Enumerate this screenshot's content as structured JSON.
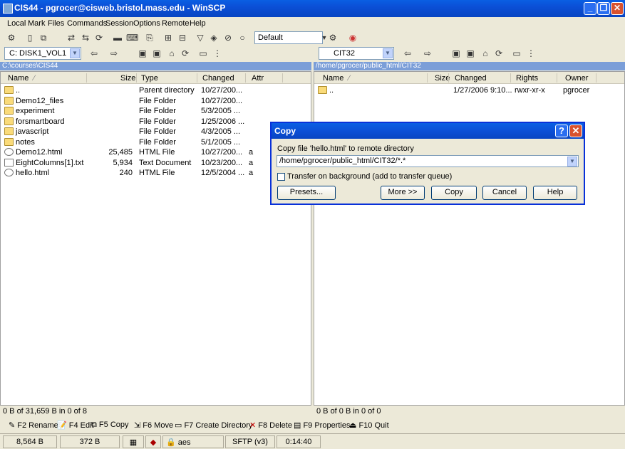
{
  "window": {
    "title": "CIS44 - pgrocer@cisweb.bristol.mass.edu - WinSCP"
  },
  "menu": [
    "Local",
    "Mark",
    "Files",
    "Commands",
    "Session",
    "Options",
    "Remote",
    "Help"
  ],
  "toolbar": {
    "profile": "Default"
  },
  "left": {
    "drive": "C: DISK1_VOL1",
    "path": "C:\\courses\\CIS44",
    "columns": [
      "Name",
      "Size",
      "Type",
      "Changed",
      "Attr"
    ],
    "rows": [
      {
        "name": "..",
        "size": "",
        "type": "Parent directory",
        "changed": "10/27/200...",
        "attr": "",
        "icon": "parent-dir-icon"
      },
      {
        "name": "Demo12_files",
        "size": "",
        "type": "File Folder",
        "changed": "10/27/200...",
        "attr": "",
        "icon": "folder-icon"
      },
      {
        "name": "experiment",
        "size": "",
        "type": "File Folder",
        "changed": "5/3/2005 ...",
        "attr": "",
        "icon": "folder-icon"
      },
      {
        "name": "forsmartboard",
        "size": "",
        "type": "File Folder",
        "changed": "1/25/2006 ...",
        "attr": "",
        "icon": "folder-icon"
      },
      {
        "name": "javascript",
        "size": "",
        "type": "File Folder",
        "changed": "4/3/2005 ...",
        "attr": "",
        "icon": "folder-icon"
      },
      {
        "name": "notes",
        "size": "",
        "type": "File Folder",
        "changed": "5/1/2005 ...",
        "attr": "",
        "icon": "folder-icon"
      },
      {
        "name": "Demo12.html",
        "size": "25,485",
        "type": "HTML File",
        "changed": "10/27/200...",
        "attr": "a",
        "icon": "html-file-icon"
      },
      {
        "name": "EightColumns[1].txt",
        "size": "5,934",
        "type": "Text Document",
        "changed": "10/23/200...",
        "attr": "a",
        "icon": "text-file-icon"
      },
      {
        "name": "hello.html",
        "size": "240",
        "type": "HTML File",
        "changed": "12/5/2004 ...",
        "attr": "a",
        "icon": "html-file-icon"
      }
    ],
    "status": "0 B of 31,659 B in 0 of 8"
  },
  "right": {
    "drive": "CIT32",
    "path": "/home/pgrocer/public_html/CIT32",
    "columns": [
      "Name",
      "Size",
      "Changed",
      "Rights",
      "Owner"
    ],
    "rows": [
      {
        "name": "..",
        "size": "",
        "changed": "1/27/2006 9:10...",
        "rights": "rwxr-xr-x",
        "owner": "pgrocer",
        "icon": "parent-dir-icon"
      }
    ],
    "status": "0 B of 0 B in 0 of 0"
  },
  "fkeys": [
    "F2 Rename",
    "F4 Edit",
    "F5 Copy",
    "F6 Move",
    "F7 Create Directory",
    "F8 Delete",
    "F9 Properties",
    "F10 Quit"
  ],
  "bottom": {
    "uploaded": "8,564 B",
    "downloaded": "372 B",
    "cipher": "aes",
    "protocol": "SFTP (v3)",
    "time": "0:14:40"
  },
  "dialog": {
    "title": "Copy",
    "label": "Copy file 'hello.html' to remote directory",
    "target": "/home/pgrocer/public_html/CIT32/*.*",
    "checkbox_label": "Transfer on background (add to transfer queue)",
    "buttons": {
      "presets": "Presets...",
      "more": "More >>",
      "copy": "Copy",
      "cancel": "Cancel",
      "help": "Help"
    }
  }
}
